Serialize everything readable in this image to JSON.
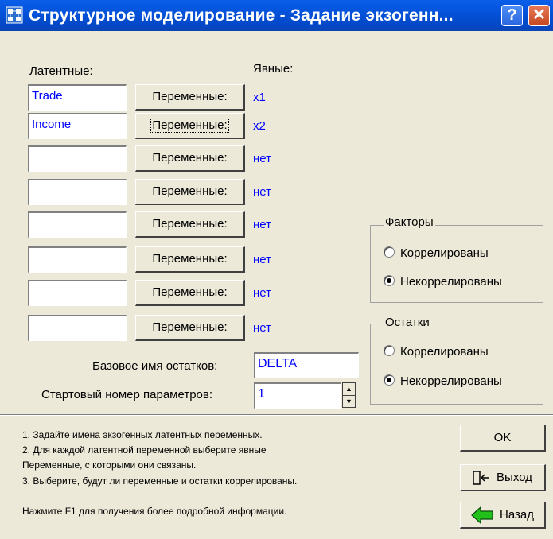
{
  "window": {
    "title": "Структурное моделирование - Задание экзогенн...",
    "help_glyph": "?",
    "close_glyph": "✕"
  },
  "labels": {
    "latent": "Латентные:",
    "manifest": "Явные:"
  },
  "rows": [
    {
      "latent": "Trade",
      "button": "Переменные:",
      "manifest": "x1"
    },
    {
      "latent": "Income",
      "button": "Переменные:",
      "manifest": "x2"
    },
    {
      "latent": "",
      "button": "Переменные:",
      "manifest": "нет"
    },
    {
      "latent": "",
      "button": "Переменные:",
      "manifest": "нет"
    },
    {
      "latent": "",
      "button": "Переменные:",
      "manifest": "нет"
    },
    {
      "latent": "",
      "button": "Переменные:",
      "manifest": "нет"
    },
    {
      "latent": "",
      "button": "Переменные:",
      "manifest": "нет"
    },
    {
      "latent": "",
      "button": "Переменные:",
      "manifest": "нет"
    }
  ],
  "factors": {
    "title": "Факторы",
    "option1": "Коррелированы",
    "option2": "Некоррелированы",
    "selected": "Некоррелированы"
  },
  "residuals": {
    "title": "Остатки",
    "option1": "Коррелированы",
    "option2": "Некоррелированы",
    "selected": "Некоррелированы"
  },
  "base_name": {
    "label": "Базовое имя остатков:",
    "value": "DELTA"
  },
  "start_number": {
    "label": "Стартовый номер параметров:",
    "value": "1"
  },
  "help": {
    "line1": "1. Задайте имена экзогенных латентных переменных.",
    "line2": "2. Для каждой латентной переменной выберите явные",
    "line3": "Переменные, с которыми они связаны.",
    "line4": "3. Выберите, будут ли переменные и остатки коррелированы.",
    "line5": "Нажмите F1 для получения более подробной информации."
  },
  "actions": {
    "ok": "OK",
    "exit": "Выход",
    "back": "Назад"
  },
  "colors": {
    "titlebar": "#0453da",
    "value_text": "#0000ff",
    "dialog_bg": "#ece9d8"
  }
}
